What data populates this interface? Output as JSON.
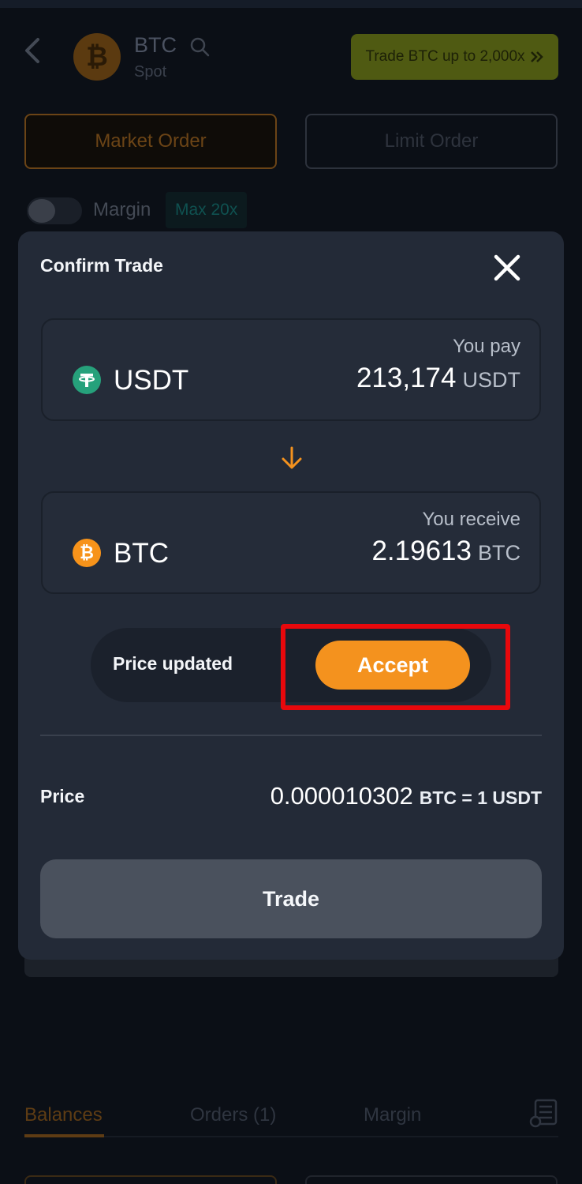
{
  "header": {
    "pair": "BTC",
    "market_type": "Spot",
    "coin_symbol": "₿",
    "promo_label": "Trade BTC up to 2,000x"
  },
  "order_tabs": [
    {
      "label": "Market Order",
      "active": true
    },
    {
      "label": "Limit Order",
      "active": false
    }
  ],
  "margin": {
    "label": "Margin",
    "badge": "Max 20x",
    "enabled": false
  },
  "bottom_tabs": [
    {
      "label": "Balances",
      "active": true
    },
    {
      "label": "Orders (1)",
      "active": false
    },
    {
      "label": "Margin",
      "active": false
    }
  ],
  "modal": {
    "title": "Confirm Trade",
    "pay": {
      "caption": "You pay",
      "asset": "USDT",
      "amount": "213,174",
      "unit": "USDT"
    },
    "receive": {
      "caption": "You receive",
      "asset": "BTC",
      "amount": "2.19613",
      "unit": "BTC",
      "icon_glyph": "₿"
    },
    "price_notice": "Price updated",
    "accept_label": "Accept",
    "price_label": "Price",
    "price_value": "0.000010302",
    "price_unit": "BTC = 1 USDT",
    "trade_label": "Trade"
  },
  "colors": {
    "accent": "#f4921e",
    "usdt": "#26a17b",
    "btc": "#f7931a",
    "highlight": "#e8080c",
    "modal_bg": "#232a37"
  }
}
